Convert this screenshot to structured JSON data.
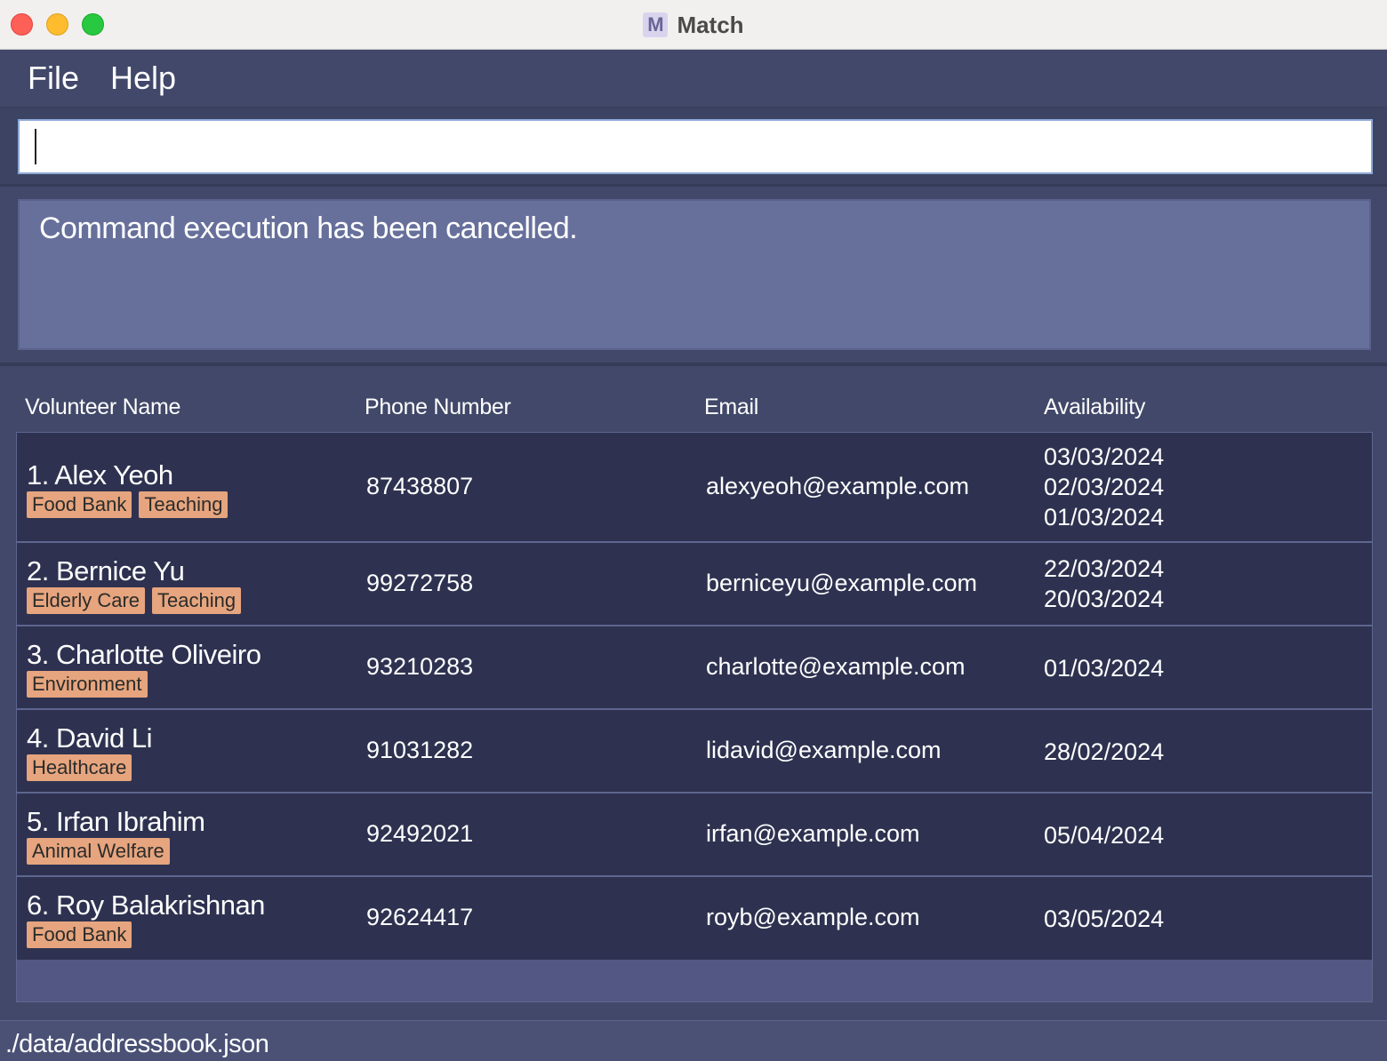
{
  "window": {
    "title": "Match",
    "icon": "app-logo-icon"
  },
  "menu": {
    "file": "File",
    "help": "Help"
  },
  "command": {
    "value": "",
    "placeholder": ""
  },
  "result": {
    "message": "Command execution has been cancelled."
  },
  "table": {
    "headers": {
      "name": "Volunteer Name",
      "phone": "Phone Number",
      "email": "Email",
      "availability": "Availability"
    },
    "rows": [
      {
        "name": "1. Alex Yeoh",
        "tags": [
          "Food Bank",
          "Teaching"
        ],
        "phone": "87438807",
        "email": "alexyeoh@example.com",
        "dates": [
          "03/03/2024",
          "02/03/2024",
          "01/03/2024"
        ]
      },
      {
        "name": "2. Bernice Yu",
        "tags": [
          "Elderly Care",
          "Teaching"
        ],
        "phone": "99272758",
        "email": "berniceyu@example.com",
        "dates": [
          "22/03/2024",
          "20/03/2024"
        ]
      },
      {
        "name": "3. Charlotte Oliveiro",
        "tags": [
          "Environment"
        ],
        "phone": "93210283",
        "email": "charlotte@example.com",
        "dates": [
          "01/03/2024"
        ]
      },
      {
        "name": "4. David Li",
        "tags": [
          "Healthcare"
        ],
        "phone": "91031282",
        "email": "lidavid@example.com",
        "dates": [
          "28/02/2024"
        ]
      },
      {
        "name": "5. Irfan Ibrahim",
        "tags": [
          "Animal Welfare"
        ],
        "phone": "92492021",
        "email": "irfan@example.com",
        "dates": [
          "05/04/2024"
        ]
      },
      {
        "name": "6. Roy Balakrishnan",
        "tags": [
          "Food Bank"
        ],
        "phone": "92624417",
        "email": "royb@example.com",
        "dates": [
          "03/05/2024"
        ]
      }
    ]
  },
  "status": {
    "path": "./data/addressbook.json"
  },
  "colors": {
    "tag": "#e6a57e",
    "row": "#2e3250",
    "background": "#414869",
    "result": "#67709b"
  }
}
